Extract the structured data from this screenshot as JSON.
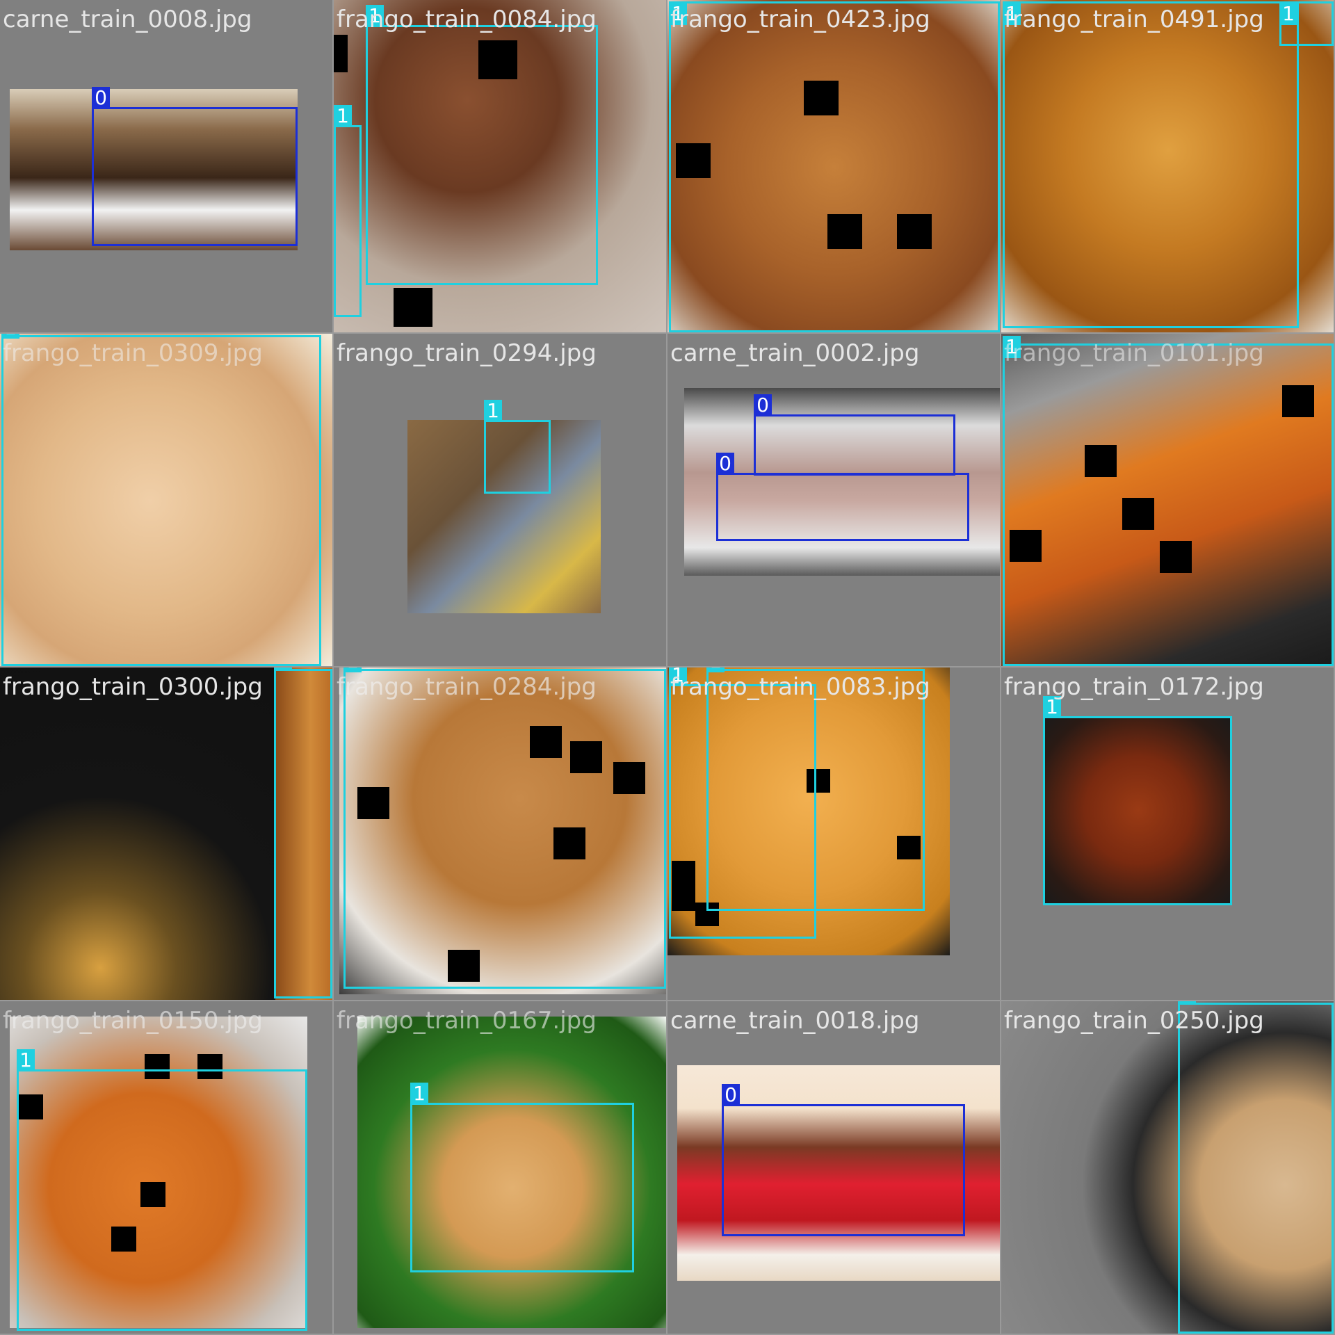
{
  "mosaic": {
    "class_colors": {
      "0": "#1c2fd6",
      "1": "#1fd0e0"
    },
    "tiles": [
      {
        "filename": "carne_train_0008.jpg",
        "boxes": [
          "0"
        ]
      },
      {
        "filename": "frango_train_0084.jpg",
        "boxes": [
          "1",
          "1"
        ]
      },
      {
        "filename": "frango_train_0423.jpg",
        "boxes": [
          "1"
        ]
      },
      {
        "filename": "frango_train_0491.jpg",
        "boxes": [
          "1",
          "1"
        ]
      },
      {
        "filename": "frango_train_0309.jpg",
        "boxes": [
          "1"
        ]
      },
      {
        "filename": "frango_train_0294.jpg",
        "boxes": [
          "1"
        ]
      },
      {
        "filename": "carne_train_0002.jpg",
        "boxes": [
          "0",
          "0"
        ]
      },
      {
        "filename": "frango_train_0101.jpg",
        "boxes": [
          "1"
        ]
      },
      {
        "filename": "frango_train_0300.jpg",
        "boxes": [
          "1"
        ]
      },
      {
        "filename": "frango_train_0284.jpg",
        "boxes": [
          "1"
        ]
      },
      {
        "filename": "frango_train_0083.jpg",
        "boxes": [
          "1",
          "1"
        ]
      },
      {
        "filename": "frango_train_0172.jpg",
        "boxes": [
          "1"
        ]
      },
      {
        "filename": "frango_train_0150.jpg",
        "boxes": [
          "1"
        ]
      },
      {
        "filename": "frango_train_0167.jpg",
        "boxes": [
          "1"
        ]
      },
      {
        "filename": "carne_train_0018.jpg",
        "boxes": [
          "0"
        ]
      },
      {
        "filename": "frango_train_0250.jpg",
        "boxes": [
          "1"
        ]
      }
    ]
  }
}
